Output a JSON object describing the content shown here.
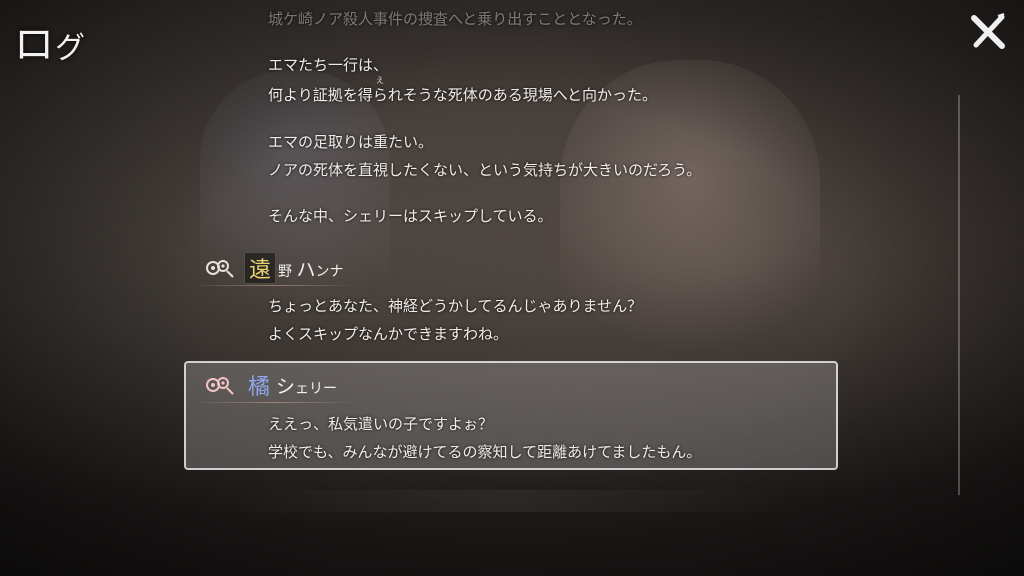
{
  "header": {
    "title_main": "ロ",
    "title_small": "グ",
    "close_icon": "close-x-icon"
  },
  "log": {
    "top_faded_line": "城ケ崎ノア殺人事件の捜査へと乗り出すこととなった。",
    "narration": [
      "エマたち一行は、",
      "何より証拠を得られそうな死体のある現場へと向かった。",
      "エマの足取りは重たい。",
      "ノアの死体を直視したくない、という気持ちが大きいのだろう。",
      "そんな中、シェリーはスキップしている。"
    ],
    "ruby_text": "え",
    "entries": [
      {
        "speaker_kanji": "遠",
        "speaker_rest_small": "野",
        "speaker_rest_big": "ハ",
        "speaker_rest_tail": "ンナ",
        "lines": [
          "ちょっとあなた、神経どうかしてるんじゃありません？",
          "よくスキップなんかできますわね。"
        ]
      },
      {
        "speaker_kanji": "橘",
        "speaker_rest_big": "シ",
        "speaker_rest_tail": "ェリー",
        "lines": [
          "ええっ、私気遣いの子ですよぉ？",
          "学校でも、みんなが避けてるの察知して距離あけてましたもん。"
        ]
      }
    ]
  },
  "colors": {
    "hanna_accent": "#e8d36c",
    "sherry_accent": "#8fa7e8",
    "selection_border": "#f0f0f0"
  }
}
